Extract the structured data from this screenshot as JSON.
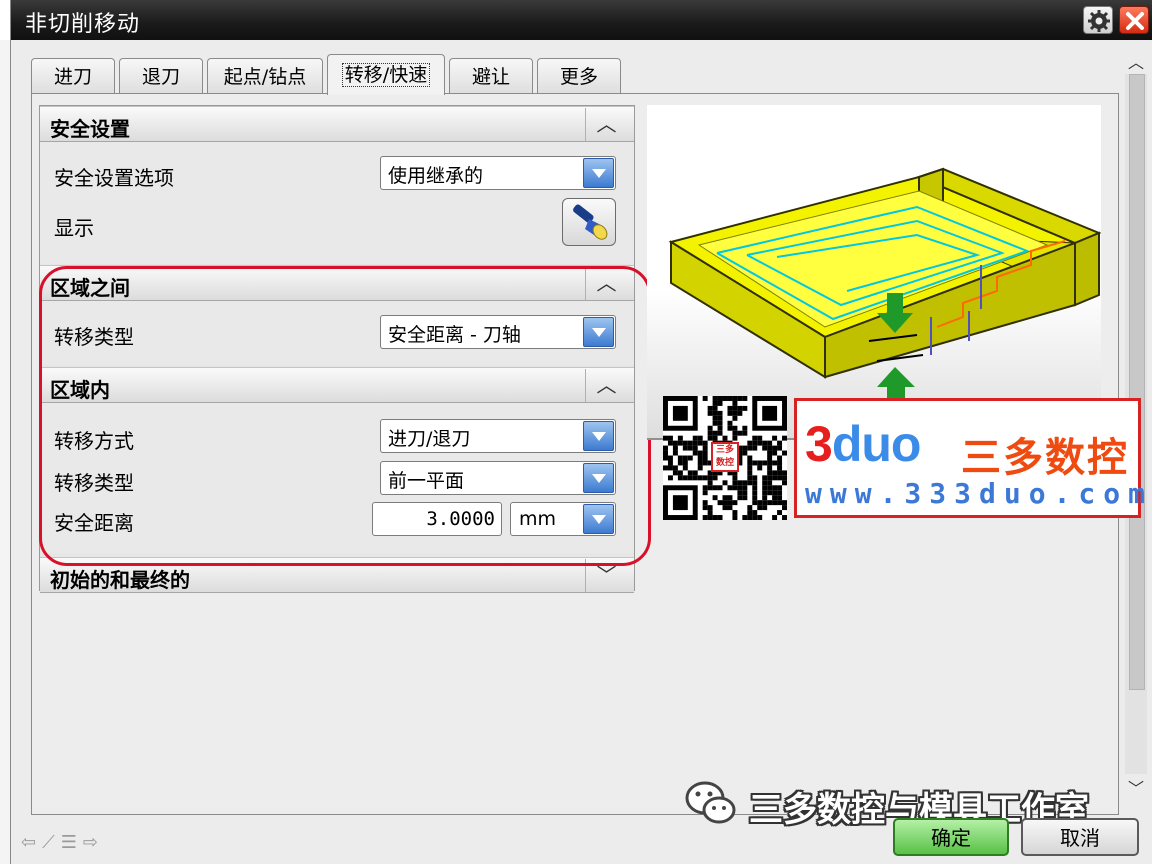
{
  "window": {
    "title": "非切削移动"
  },
  "tabs": [
    {
      "label": "进刀",
      "active": false
    },
    {
      "label": "退刀",
      "active": false
    },
    {
      "label": "起点/钻点",
      "active": false
    },
    {
      "label": "转移/快速",
      "active": true
    },
    {
      "label": "避让",
      "active": false
    },
    {
      "label": "更多",
      "active": false
    }
  ],
  "safety": {
    "header": "安全设置",
    "option_label": "安全设置选项",
    "option_value": "使用继承的",
    "display_label": "显示"
  },
  "between_regions": {
    "header": "区域之间",
    "transfer_type_label": "转移类型",
    "transfer_type_value": "安全距离 - 刀轴"
  },
  "within_region": {
    "header": "区域内",
    "method_label": "转移方式",
    "method_value": "进刀/退刀",
    "transfer_type_label": "转移类型",
    "transfer_type_value": "前一平面",
    "safe_distance_label": "安全距离",
    "safe_distance_value": "3.0000",
    "safe_distance_unit": "mm"
  },
  "initial_final": {
    "header": "初始的和最终的"
  },
  "watermark": {
    "logo_digit": "3",
    "logo_text": "duo",
    "cn_name": "三多数控",
    "url": "www.333duo.com",
    "qr_badge": "三多数控"
  },
  "footer": {
    "channel_name": "三多数控与模具工作室",
    "ok_label": "确定",
    "cancel_label": "取消"
  },
  "colors": {
    "accent_blue": "#3d7bd0",
    "highlight_red": "#d8102a",
    "part_yellow": "#e8e800",
    "toolpath_cyan": "#00d0e0",
    "arrow_green": "#1f9a2a"
  }
}
